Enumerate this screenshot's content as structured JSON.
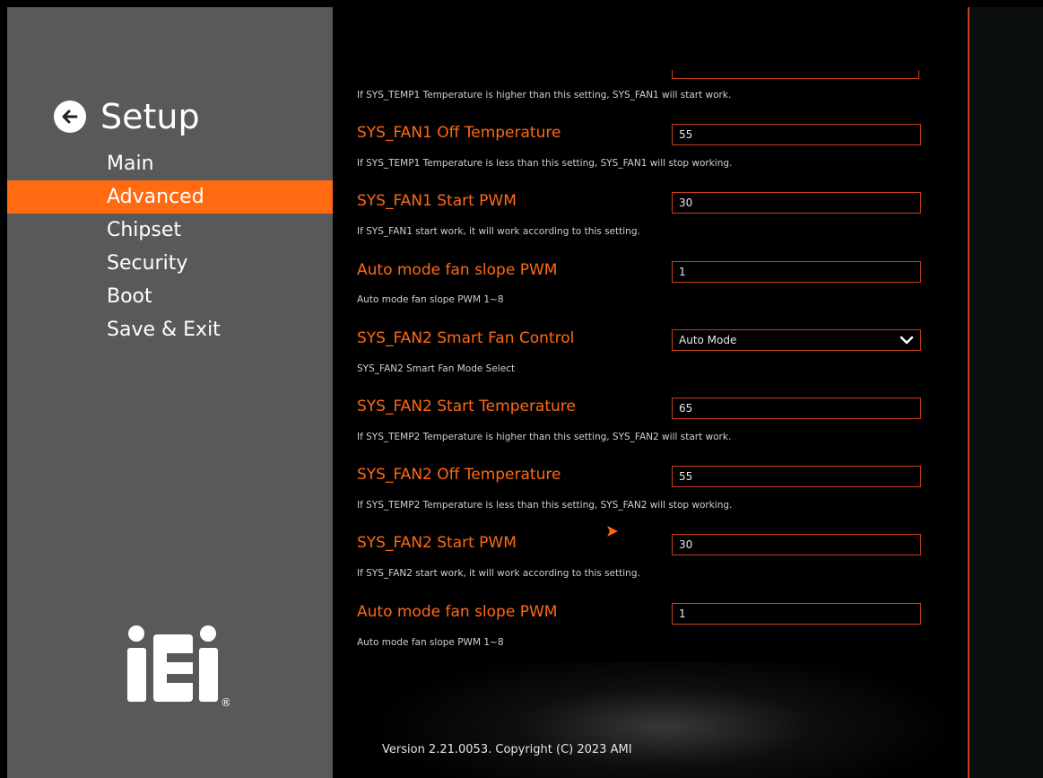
{
  "sidebar": {
    "title": "Setup",
    "menu": [
      {
        "label": "Main",
        "active": false
      },
      {
        "label": "Advanced",
        "active": true
      },
      {
        "label": "Chipset",
        "active": false
      },
      {
        "label": "Security",
        "active": false
      },
      {
        "label": "Boot",
        "active": false
      },
      {
        "label": "Save & Exit",
        "active": false
      }
    ],
    "logo_text": "iEi",
    "logo_mark": "®"
  },
  "main": {
    "top_help": "If SYS_TEMP1 Temperature is higher than this setting, SYS_FAN1 will start work.",
    "settings": [
      {
        "label": "SYS_FAN1 Off Temperature",
        "value": "55",
        "help": "If SYS_TEMP1 Temperature is less than this setting, SYS_FAN1 will stop working."
      },
      {
        "label": "SYS_FAN1 Start PWM",
        "value": "30",
        "help": "If SYS_FAN1 start work, it will work according to this setting."
      },
      {
        "label": "Auto mode fan slope PWM",
        "value": "1",
        "help": "Auto mode fan slope PWM 1~8"
      },
      {
        "label": "SYS_FAN2 Smart Fan Control",
        "value": "Auto Mode",
        "help": "SYS_FAN2 Smart Fan Mode Select"
      },
      {
        "label": "SYS_FAN2 Start Temperature",
        "value": "65",
        "help": "If SYS_TEMP2 Temperature is higher than this setting, SYS_FAN2 will start work."
      },
      {
        "label": "SYS_FAN2 Off Temperature",
        "value": "55",
        "help": "If SYS_TEMP2 Temperature is less than this setting, SYS_FAN2 will stop working."
      },
      {
        "label": "SYS_FAN2 Start PWM",
        "value": "30",
        "help": "If SYS_FAN2 start work, it will work according to this setting."
      },
      {
        "label": "Auto mode fan slope PWM",
        "value": "1",
        "help": "Auto mode fan slope PWM 1~8"
      }
    ],
    "version": "Version 2.21.0053. Copyright (C) 2023 AMI"
  },
  "colors": {
    "accent": "#ff6a13",
    "sidebar_bg": "#595959",
    "field_border": "#c8401a"
  }
}
